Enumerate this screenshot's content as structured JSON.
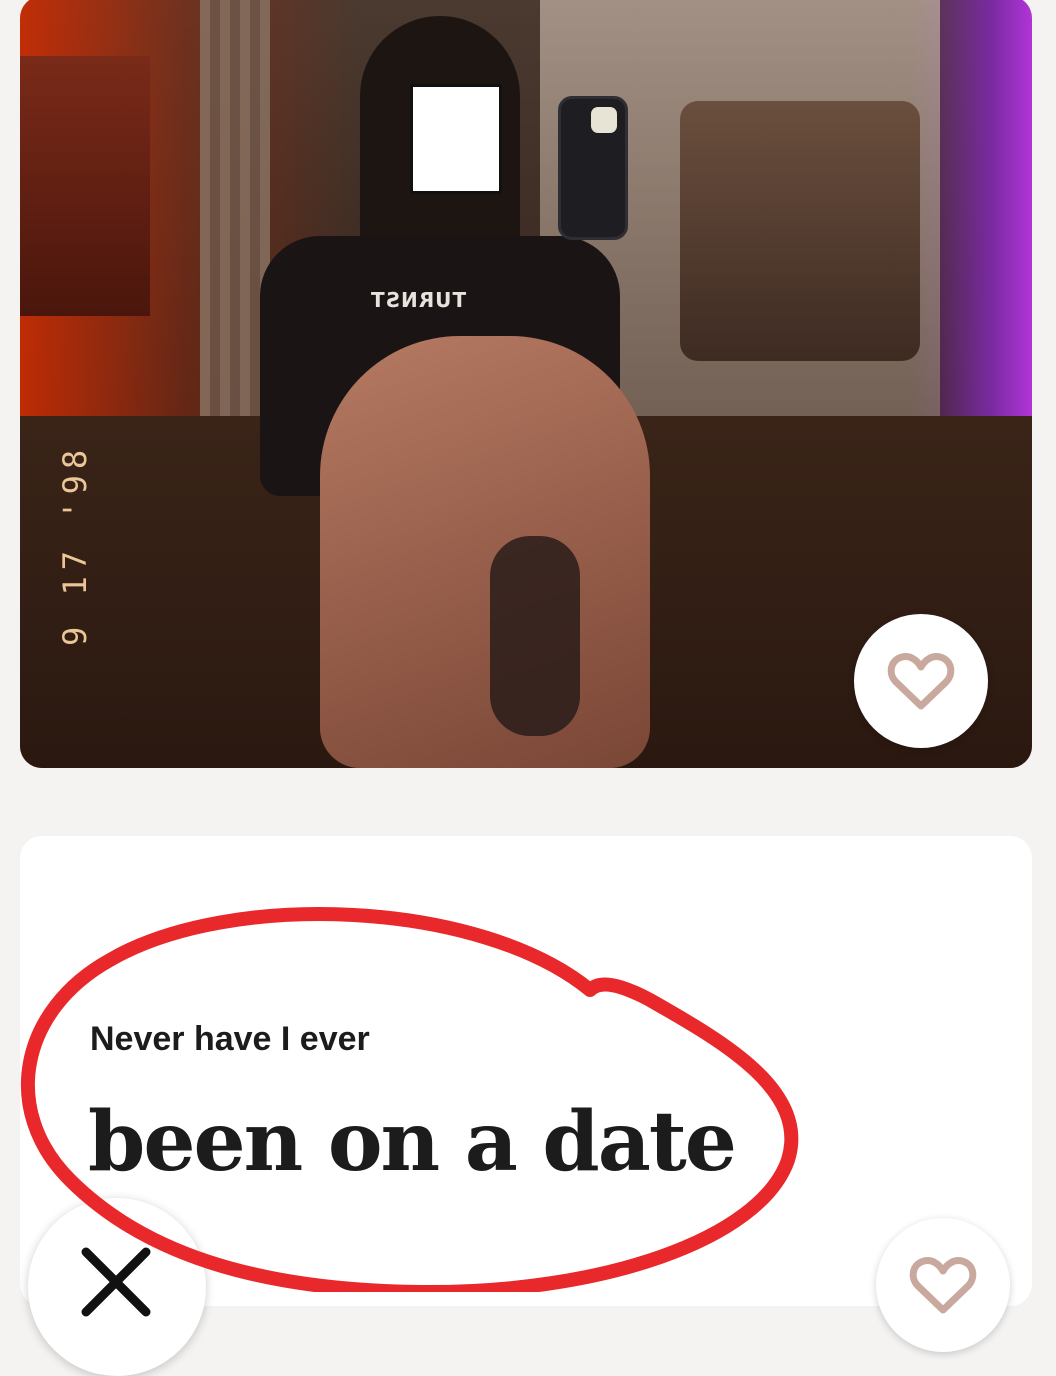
{
  "photo": {
    "shirt_text": "TURNST",
    "date_stamp": "9 17 '98",
    "like_icon": "heart-icon"
  },
  "prompt": {
    "label": "Never have I ever",
    "answer": "been on a date",
    "like_icon": "heart-icon"
  },
  "actions": {
    "skip_icon": "close-icon"
  },
  "colors": {
    "annotation": "#e8282b",
    "heart_outline": "#c9a99e",
    "text": "#1c1c1c"
  }
}
